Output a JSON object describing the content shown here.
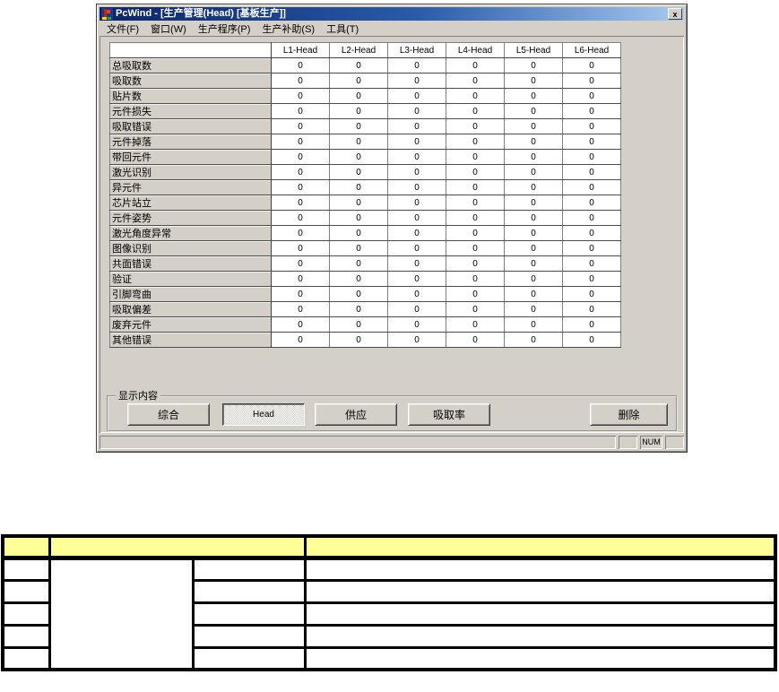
{
  "app_window": {
    "title": "PcWind - [生产管理(Head) [基板生产]]",
    "close_button": "x",
    "menu_items": [
      "文件(F)",
      "窗口(W)",
      "生产程序(P)",
      "生产补助(S)",
      "工具(T)"
    ]
  },
  "stats_table": {
    "columns": [
      "L1-Head",
      "L2-Head",
      "L3-Head",
      "L4-Head",
      "L5-Head",
      "L6-Head"
    ],
    "rows": [
      {
        "label": "总吸取数",
        "values": [
          "0",
          "0",
          "0",
          "0",
          "0",
          "0"
        ]
      },
      {
        "label": "吸取数",
        "values": [
          "0",
          "0",
          "0",
          "0",
          "0",
          "0"
        ]
      },
      {
        "label": "贴片数",
        "values": [
          "0",
          "0",
          "0",
          "0",
          "0",
          "0"
        ]
      },
      {
        "label": "元件损失",
        "values": [
          "0",
          "0",
          "0",
          "0",
          "0",
          "0"
        ]
      },
      {
        "label": "吸取错误",
        "values": [
          "0",
          "0",
          "0",
          "0",
          "0",
          "0"
        ]
      },
      {
        "label": "元件掉落",
        "values": [
          "0",
          "0",
          "0",
          "0",
          "0",
          "0"
        ]
      },
      {
        "label": "带回元件",
        "values": [
          "0",
          "0",
          "0",
          "0",
          "0",
          "0"
        ]
      },
      {
        "label": "激光识别",
        "values": [
          "0",
          "0",
          "0",
          "0",
          "0",
          "0"
        ]
      },
      {
        "label": "异元件",
        "values": [
          "0",
          "0",
          "0",
          "0",
          "0",
          "0"
        ]
      },
      {
        "label": "芯片站立",
        "values": [
          "0",
          "0",
          "0",
          "0",
          "0",
          "0"
        ]
      },
      {
        "label": "元件姿势",
        "values": [
          "0",
          "0",
          "0",
          "0",
          "0",
          "0"
        ]
      },
      {
        "label": "激光角度异常",
        "values": [
          "0",
          "0",
          "0",
          "0",
          "0",
          "0"
        ]
      },
      {
        "label": "图像识别",
        "values": [
          "0",
          "0",
          "0",
          "0",
          "0",
          "0"
        ]
      },
      {
        "label": "共面错误",
        "values": [
          "0",
          "0",
          "0",
          "0",
          "0",
          "0"
        ]
      },
      {
        "label": "验证",
        "values": [
          "0",
          "0",
          "0",
          "0",
          "0",
          "0"
        ]
      },
      {
        "label": "引脚弯曲",
        "values": [
          "0",
          "0",
          "0",
          "0",
          "0",
          "0"
        ]
      },
      {
        "label": "吸取偏差",
        "values": [
          "0",
          "0",
          "0",
          "0",
          "0",
          "0"
        ]
      },
      {
        "label": "废弃元件",
        "values": [
          "0",
          "0",
          "0",
          "0",
          "0",
          "0"
        ]
      },
      {
        "label": "其他错误",
        "values": [
          "0",
          "0",
          "0",
          "0",
          "0",
          "0"
        ]
      }
    ]
  },
  "display_panel": {
    "group_label": "显示内容",
    "buttons": [
      {
        "label": "综合",
        "pressed": false
      },
      {
        "label": "Head",
        "pressed": true
      },
      {
        "label": "供应",
        "pressed": false
      },
      {
        "label": "吸取率",
        "pressed": false
      }
    ],
    "delete_button": {
      "label": "删除"
    }
  },
  "status_bar": {
    "num_indicator": "NUM"
  },
  "bottom_table": {
    "header_color": "#ffff99",
    "header_cells": [
      "",
      "",
      ""
    ],
    "body_row_count": 5,
    "cells_empty": true
  },
  "colors": {
    "titlebar_gradient_start": "#0a246a",
    "titlebar_gradient_end": "#a6caf0",
    "window_chrome": "#d4d0c8",
    "bottom_header_yellow": "#ffff99"
  }
}
